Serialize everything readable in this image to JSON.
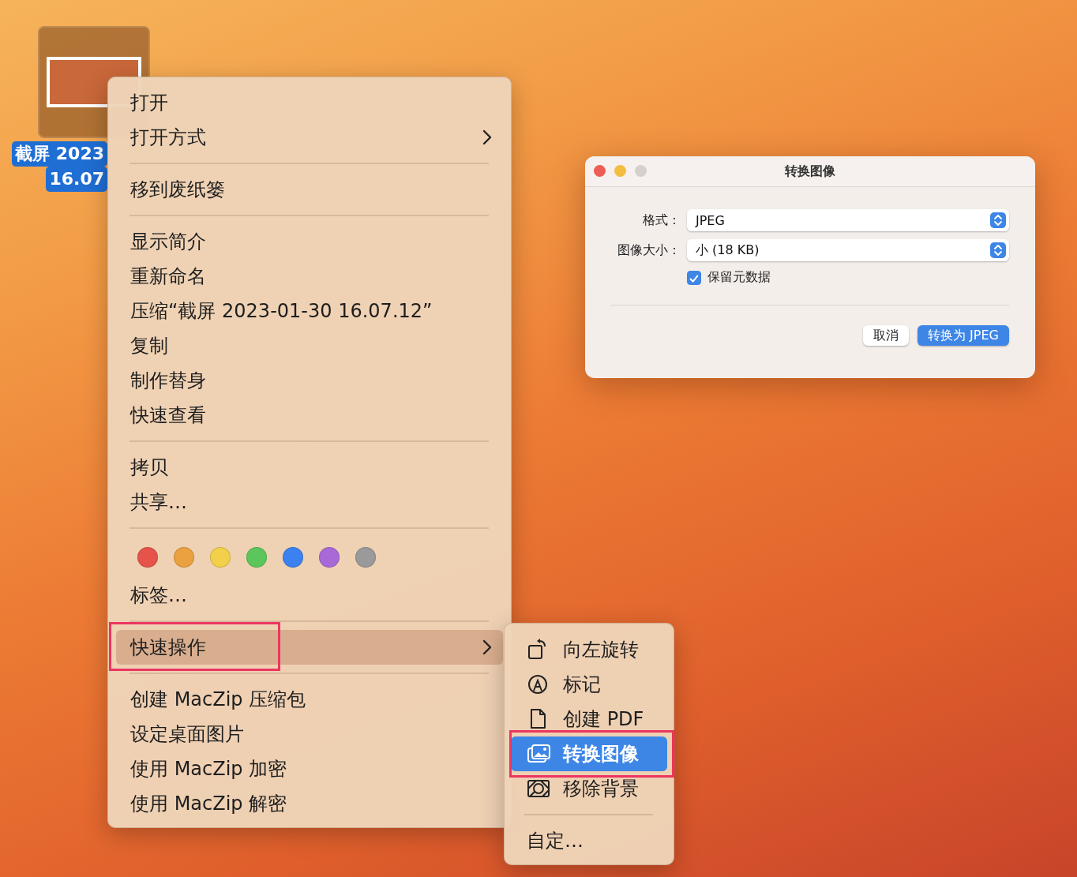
{
  "desktop_icon": {
    "label_lines": [
      "截屏 2023",
      "16.07"
    ],
    "selected": true
  },
  "context_menu": {
    "sections": [
      {
        "items": [
          {
            "kind": "action",
            "label": "打开",
            "submenu": false,
            "highlighted": false,
            "outlined": false
          },
          {
            "kind": "action",
            "label": "打开方式",
            "submenu": true,
            "highlighted": false,
            "outlined": false
          }
        ]
      },
      {
        "items": [
          {
            "kind": "action",
            "label": "移到废纸篓",
            "submenu": false,
            "highlighted": false,
            "outlined": false
          }
        ]
      },
      {
        "items": [
          {
            "kind": "action",
            "label": "显示简介",
            "submenu": false,
            "highlighted": false,
            "outlined": false
          },
          {
            "kind": "action",
            "label": "重新命名",
            "submenu": false,
            "highlighted": false,
            "outlined": false
          },
          {
            "kind": "action",
            "label": "压缩“截屏 2023-01-30 16.07.12”",
            "submenu": false,
            "highlighted": false,
            "outlined": false
          },
          {
            "kind": "action",
            "label": "复制",
            "submenu": false,
            "highlighted": false,
            "outlined": false
          },
          {
            "kind": "action",
            "label": "制作替身",
            "submenu": false,
            "highlighted": false,
            "outlined": false
          },
          {
            "kind": "action",
            "label": "快速查看",
            "submenu": false,
            "highlighted": false,
            "outlined": false
          }
        ]
      },
      {
        "items": [
          {
            "kind": "action",
            "label": "拷贝",
            "submenu": false,
            "highlighted": false,
            "outlined": false
          },
          {
            "kind": "action",
            "label": "共享…",
            "submenu": false,
            "highlighted": false,
            "outlined": false
          }
        ]
      },
      {
        "items": [
          {
            "kind": "tags",
            "tags": [
              {
                "color": "#e5534b"
              },
              {
                "color": "#eba13f"
              },
              {
                "color": "#f2d04a"
              },
              {
                "color": "#5cc65a"
              },
              {
                "color": "#3b82f0"
              },
              {
                "color": "#a86ad6"
              },
              {
                "color": "#9a9a9a"
              }
            ]
          },
          {
            "kind": "action",
            "label": "标签…",
            "submenu": false,
            "highlighted": false,
            "outlined": false
          }
        ]
      },
      {
        "items": [
          {
            "kind": "action",
            "label": "快速操作",
            "submenu": true,
            "highlighted": true,
            "outlined": true
          }
        ]
      },
      {
        "items": [
          {
            "kind": "action",
            "label": "创建 MacZip 压缩包",
            "submenu": false,
            "highlighted": false,
            "outlined": false
          },
          {
            "kind": "action",
            "label": "设定桌面图片",
            "submenu": false,
            "highlighted": false,
            "outlined": false
          },
          {
            "kind": "action",
            "label": "使用 MacZip 加密",
            "submenu": false,
            "highlighted": false,
            "outlined": false
          },
          {
            "kind": "action",
            "label": "使用 MacZip 解密",
            "submenu": false,
            "highlighted": false,
            "outlined": false
          }
        ]
      }
    ]
  },
  "submenu": {
    "sections": [
      {
        "items": [
          {
            "kind": "rotate",
            "label": "向左旋转",
            "highlighted": false,
            "outlined": false
          },
          {
            "kind": "markup",
            "label": "标记",
            "highlighted": false,
            "outlined": false
          },
          {
            "kind": "pdf",
            "label": "创建 PDF",
            "highlighted": false,
            "outlined": false
          },
          {
            "kind": "convert",
            "label": "转换图像",
            "highlighted": true,
            "outlined": true
          },
          {
            "kind": "remove-background",
            "label": "移除背景",
            "highlighted": false,
            "outlined": false
          }
        ]
      },
      {
        "items": [
          {
            "kind": "plain",
            "label": "自定…",
            "highlighted": false,
            "outlined": false
          }
        ]
      }
    ]
  },
  "dialog": {
    "title": "转换图像",
    "window_buttons": [
      {
        "kind": "close",
        "disabled": false
      },
      {
        "kind": "minimize",
        "disabled": false
      },
      {
        "kind": "zoom",
        "disabled": true
      }
    ],
    "fields": [
      {
        "label": "格式：",
        "value": "JPEG"
      },
      {
        "label": "图像大小：",
        "value": "小 (18 KB)"
      }
    ],
    "checkbox": {
      "label": "保留元数据",
      "checked": true
    },
    "buttons": [
      {
        "label": "取消",
        "default": false
      },
      {
        "label": "转换为 JPEG",
        "default": true
      }
    ]
  }
}
